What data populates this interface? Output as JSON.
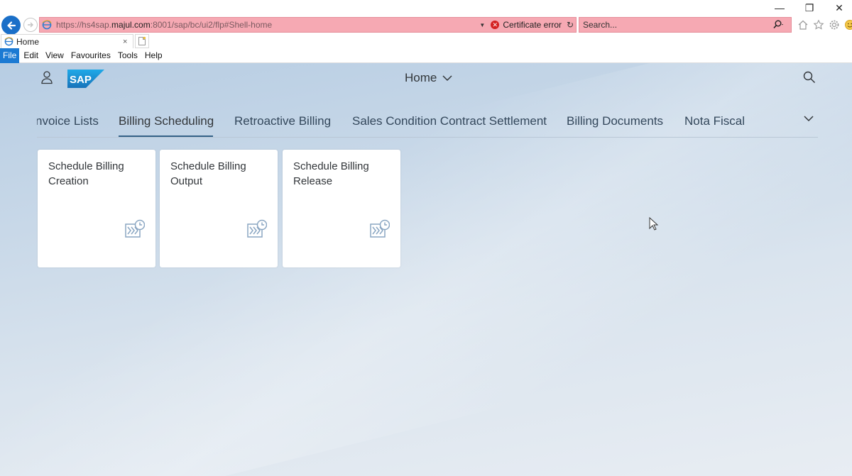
{
  "browser": {
    "url_prefix": "https://hs4sap.",
    "url_host": "majul.com",
    "url_suffix": ":8001/sap/bc/ui2/flp#Shell-home",
    "certificate_error": "Certificate error",
    "search_placeholder": "Search...",
    "tab_title": "Home",
    "tab_close": "×",
    "window_controls": {
      "minimize": "—",
      "restore": "❐",
      "close": "✕"
    }
  },
  "menu": [
    "File",
    "Edit",
    "View",
    "Favourites",
    "Tools",
    "Help"
  ],
  "shell": {
    "title": "Home",
    "logo_text": "SAP"
  },
  "tabs": [
    {
      "label": "nvoice Lists",
      "selected": false
    },
    {
      "label": "Billing Scheduling",
      "selected": true
    },
    {
      "label": "Retroactive Billing",
      "selected": false
    },
    {
      "label": "Sales Condition Contract Settlement",
      "selected": false
    },
    {
      "label": "Billing Documents",
      "selected": false
    },
    {
      "label": "Nota Fiscal",
      "selected": false
    }
  ],
  "tiles": [
    {
      "title": "Schedule Billing Creation",
      "icon": "schedule-billing-icon"
    },
    {
      "title": "Schedule Billing Output",
      "icon": "schedule-billing-icon"
    },
    {
      "title": "Schedule Billing Release",
      "icon": "schedule-billing-icon"
    }
  ],
  "colors": {
    "accent": "#346187",
    "insecure_bar": "#f6a9b3",
    "menu_active": "#1c7ad3",
    "sap_logo": "#1e8ed8"
  }
}
